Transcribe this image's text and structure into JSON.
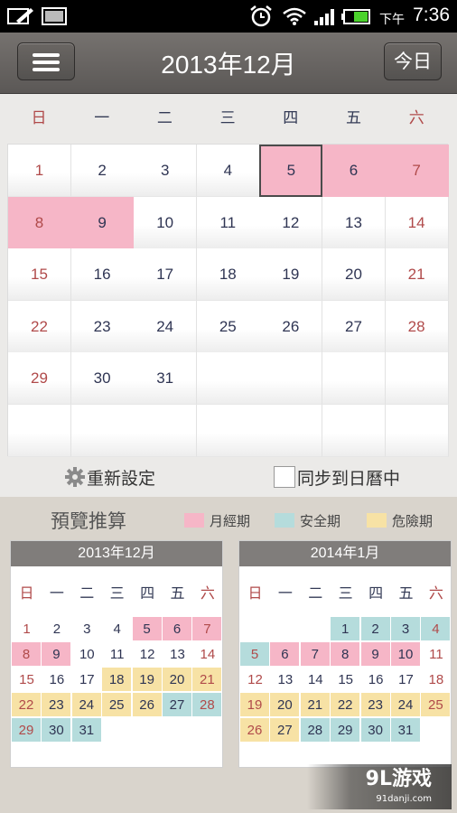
{
  "status_bar": {
    "ampm": "下午",
    "time": "7:36"
  },
  "header": {
    "title": "2013年12月",
    "today_label": "今日"
  },
  "weekdays": [
    "日",
    "一",
    "二",
    "三",
    "四",
    "五",
    "六"
  ],
  "main_calendar": {
    "rows": [
      [
        "1",
        "2",
        "3",
        "4",
        "5",
        "6",
        "7"
      ],
      [
        "8",
        "9",
        "10",
        "11",
        "12",
        "13",
        "14"
      ],
      [
        "15",
        "16",
        "17",
        "18",
        "19",
        "20",
        "21"
      ],
      [
        "22",
        "23",
        "24",
        "25",
        "26",
        "27",
        "28"
      ],
      [
        "29",
        "30",
        "31",
        "",
        "",
        "",
        ""
      ],
      [
        "",
        "",
        "",
        "",
        "",
        "",
        ""
      ]
    ],
    "period_days": [
      "5",
      "6",
      "7",
      "8",
      "9"
    ],
    "selected_day": "5"
  },
  "actions": {
    "reset_label": "重新設定",
    "sync_label": "同步到日曆中"
  },
  "preview": {
    "title": "預覽推算",
    "legend": [
      {
        "label": "月經期",
        "color": "#f6b6c7"
      },
      {
        "label": "安全期",
        "color": "#b5dcdc"
      },
      {
        "label": "危險期",
        "color": "#f7e2a5"
      }
    ],
    "months": [
      {
        "title": "2013年12月",
        "rows": [
          [
            [
              "1",
              ""
            ],
            [
              "2",
              ""
            ],
            [
              "3",
              ""
            ],
            [
              "4",
              ""
            ],
            [
              "5",
              "p"
            ],
            [
              "6",
              "p"
            ],
            [
              "7",
              "p"
            ]
          ],
          [
            [
              "8",
              "p"
            ],
            [
              "9",
              "p"
            ],
            [
              "10",
              ""
            ],
            [
              "11",
              ""
            ],
            [
              "12",
              ""
            ],
            [
              "13",
              ""
            ],
            [
              "14",
              ""
            ]
          ],
          [
            [
              "15",
              ""
            ],
            [
              "16",
              ""
            ],
            [
              "17",
              ""
            ],
            [
              "18",
              "d"
            ],
            [
              "19",
              "d"
            ],
            [
              "20",
              "d"
            ],
            [
              "21",
              "d"
            ]
          ],
          [
            [
              "22",
              "d"
            ],
            [
              "23",
              "d"
            ],
            [
              "24",
              "d"
            ],
            [
              "25",
              "d"
            ],
            [
              "26",
              "d"
            ],
            [
              "27",
              "s"
            ],
            [
              "28",
              "s"
            ]
          ],
          [
            [
              "29",
              "s"
            ],
            [
              "30",
              "s"
            ],
            [
              "31",
              "s"
            ],
            [
              "",
              ""
            ],
            [
              "",
              ""
            ],
            [
              "",
              ""
            ],
            [
              "",
              ""
            ]
          ]
        ]
      },
      {
        "title": "2014年1月",
        "rows": [
          [
            [
              "",
              ""
            ],
            [
              "",
              ""
            ],
            [
              "",
              ""
            ],
            [
              "1",
              "s"
            ],
            [
              "2",
              "s"
            ],
            [
              "3",
              "s"
            ],
            [
              "4",
              "s"
            ]
          ],
          [
            [
              "5",
              "s"
            ],
            [
              "6",
              "p"
            ],
            [
              "7",
              "p"
            ],
            [
              "8",
              "p"
            ],
            [
              "9",
              "p"
            ],
            [
              "10",
              "p"
            ],
            [
              "11",
              ""
            ]
          ],
          [
            [
              "12",
              ""
            ],
            [
              "13",
              ""
            ],
            [
              "14",
              ""
            ],
            [
              "15",
              ""
            ],
            [
              "16",
              ""
            ],
            [
              "17",
              ""
            ],
            [
              "18",
              ""
            ]
          ],
          [
            [
              "19",
              "d"
            ],
            [
              "20",
              "d"
            ],
            [
              "21",
              "d"
            ],
            [
              "22",
              "d"
            ],
            [
              "23",
              "d"
            ],
            [
              "24",
              "d"
            ],
            [
              "25",
              "d"
            ]
          ],
          [
            [
              "26",
              "d"
            ],
            [
              "27",
              "d"
            ],
            [
              "28",
              "s"
            ],
            [
              "29",
              "s"
            ],
            [
              "30",
              "s"
            ],
            [
              "31",
              "s"
            ],
            [
              "",
              ""
            ]
          ]
        ]
      }
    ]
  },
  "watermark": {
    "logo": "9L游戏",
    "url": "91danji.com"
  },
  "colors": {
    "period": "#f6b6c7",
    "safe": "#b5dcdc",
    "danger": "#f7e2a5"
  }
}
